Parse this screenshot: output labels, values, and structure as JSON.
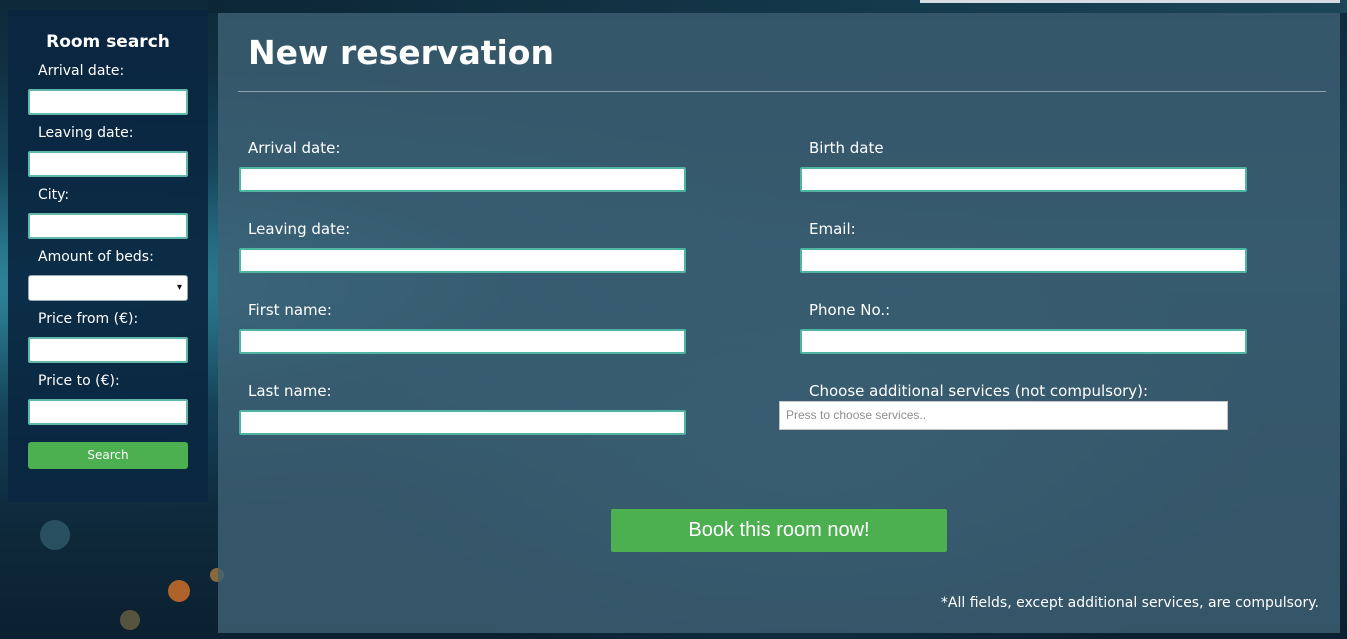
{
  "sidebar": {
    "title": "Room search",
    "fields": {
      "arrival_label": "Arrival date:",
      "leaving_label": "Leaving date:",
      "city_label": "City:",
      "beds_label": "Amount of beds:",
      "price_from_label": "Price from (€):",
      "price_to_label": "Price to (€):"
    },
    "search_label": "Search"
  },
  "reservation": {
    "title": "New reservation",
    "left": {
      "arrival_label": "Arrival date:",
      "leaving_label": "Leaving date:",
      "first_name_label": "First name:",
      "last_name_label": "Last name:"
    },
    "right": {
      "birth_label": "Birth date",
      "email_label": "Email:",
      "phone_label": "Phone No.:",
      "services_label": "Choose additional services (not compulsory):",
      "services_placeholder": "Press to choose services.."
    },
    "book_label": "Book this room now!",
    "footnote": "*All fields, except additional services, are compulsory."
  },
  "colors": {
    "accent_green": "#4caf50",
    "sidebar_bg": "#0a2640",
    "panel_bg": "#3e6074",
    "input_border": "#4fb5a2"
  },
  "icons": {
    "select_caret": "▾"
  }
}
